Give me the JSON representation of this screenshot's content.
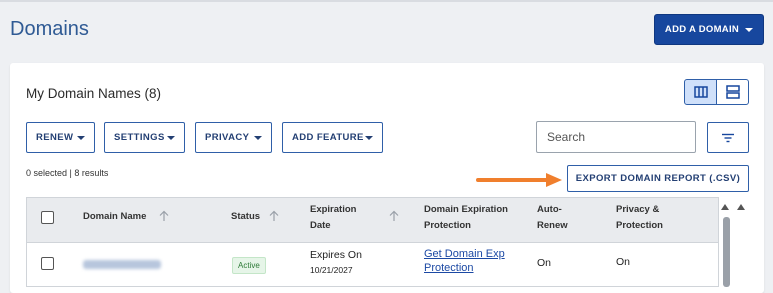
{
  "page": {
    "title": "Domains"
  },
  "header": {
    "add_domain_label": "ADD A DOMAIN"
  },
  "section": {
    "title": "My Domain Names (8)"
  },
  "toolbar": {
    "renew_label": "RENEW",
    "settings_label": "SETTINGS",
    "privacy_label": "PRIVACY",
    "add_feature_label": "ADD FEATURE"
  },
  "search": {
    "placeholder": "Search",
    "value": ""
  },
  "selection": {
    "info": "0 selected | 8 results"
  },
  "export": {
    "label": "EXPORT DOMAIN REPORT (.CSV)"
  },
  "table": {
    "headers": {
      "domain_name": "Domain Name",
      "status": "Status",
      "expiration_line1": "Expiration",
      "expiration_line2": "Date",
      "protection_line1": "Domain Expiration",
      "protection_line2": "Protection",
      "autorenew_line1": "Auto-",
      "autorenew_line2": "Renew",
      "privacy_line1": "Privacy &",
      "privacy_line2": "Protection"
    },
    "rows": [
      {
        "status": "Active",
        "expires_label": "Expires On",
        "expires_date": "10/21/2027",
        "protection_link_line1": "Get Domain Exp",
        "protection_link_line2": "Protection",
        "auto_renew": "On",
        "privacy": "On"
      }
    ]
  },
  "colors": {
    "primary": "#17479e",
    "accent_border": "#2f5fa8",
    "arrow": "#f07f2d",
    "status_active": "#2d7a37"
  },
  "icons": {
    "view_grid": "columns-icon",
    "view_list": "rows-icon",
    "search": "search-icon",
    "filter": "filter-icon",
    "annotation": "arrow-right-icon"
  }
}
